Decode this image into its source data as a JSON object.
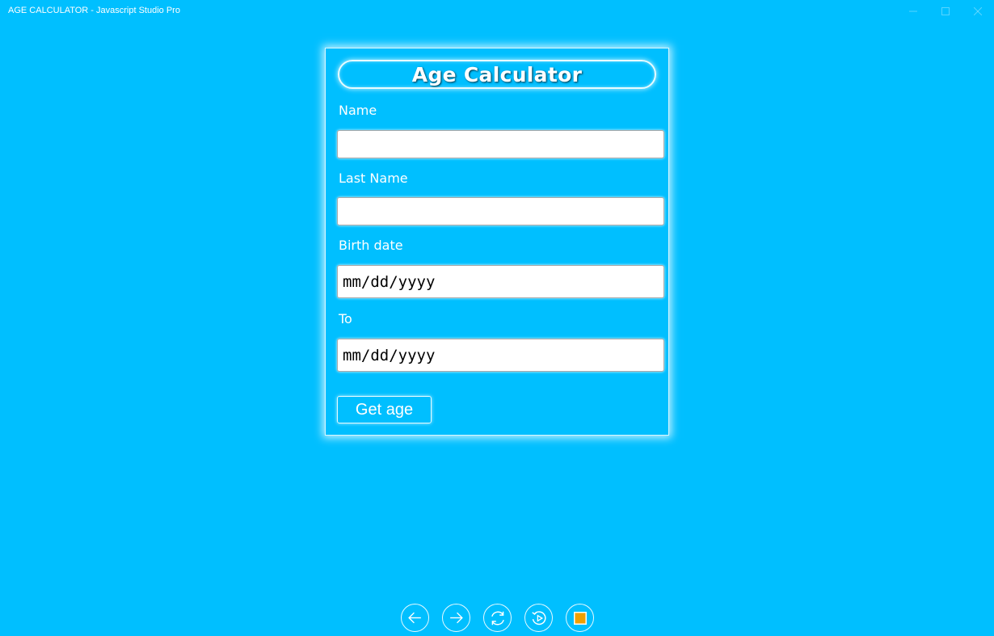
{
  "window": {
    "title": "AGE CALCULATOR - Javascript Studio Pro",
    "controls": {
      "minimize_icon": "minimize-icon",
      "maximize_icon": "maximize-icon",
      "close_icon": "close-icon"
    }
  },
  "form": {
    "title": "Age Calculator",
    "name_label": "Name",
    "name_value": "",
    "last_name_label": "Last Name",
    "last_name_value": "",
    "birth_date_label": "Birth date",
    "birth_date_placeholder": "mm/dd/yyyy",
    "to_label": "To",
    "to_placeholder": "mm/dd/yyyy",
    "submit_label": "Get age"
  },
  "bottom_nav": [
    {
      "name": "back",
      "icon": "arrow-left-icon"
    },
    {
      "name": "forward",
      "icon": "arrow-right-icon"
    },
    {
      "name": "refresh",
      "icon": "refresh-icon"
    },
    {
      "name": "replay",
      "icon": "replay-icon"
    },
    {
      "name": "stop",
      "icon": "stop-icon"
    }
  ],
  "colors": {
    "background": "#00bfff",
    "glow": "#d9f6ff",
    "stop_accent": "#f0a000"
  }
}
